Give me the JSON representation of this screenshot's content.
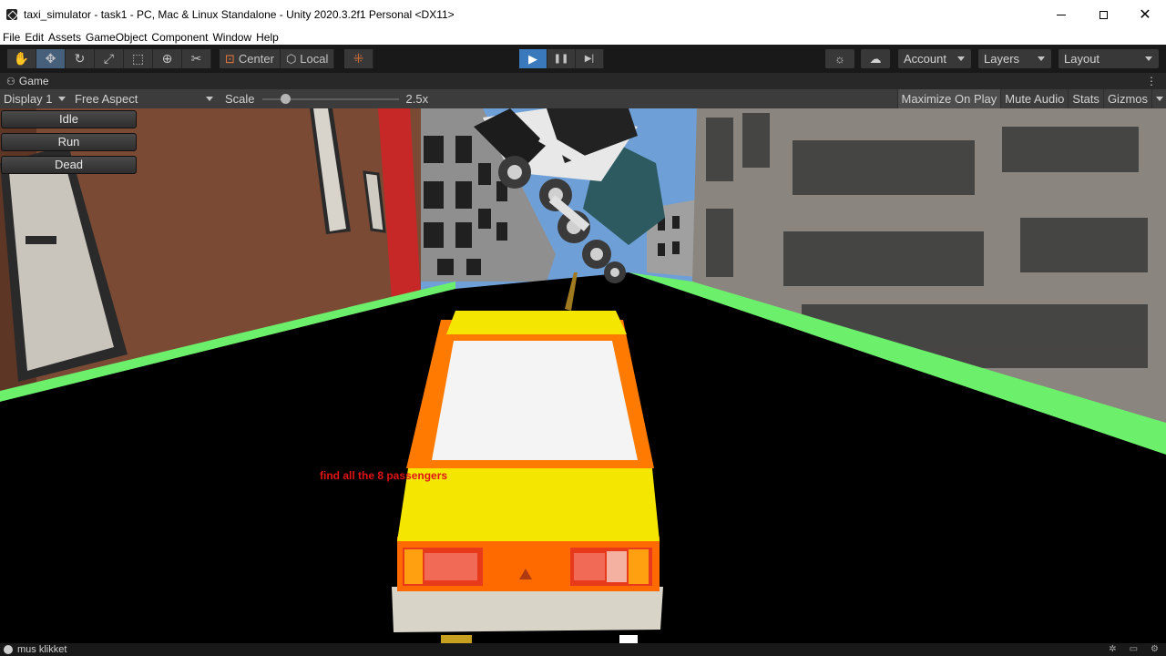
{
  "window": {
    "title": "taxi_simulator - task1 - PC, Mac & Linux Standalone - Unity 2020.3.2f1 Personal <DX11>",
    "minimize_glyph": "—",
    "maximize_glyph": "☐",
    "close_glyph": "✕"
  },
  "menu": [
    "File",
    "Edit",
    "Assets",
    "GameObject",
    "Component",
    "Window",
    "Help"
  ],
  "toolbar": {
    "tools": [
      {
        "name": "hand-tool",
        "glyph": "✋"
      },
      {
        "name": "move-tool",
        "glyph": "✥"
      },
      {
        "name": "rotate-tool",
        "glyph": "↻"
      },
      {
        "name": "scale-tool",
        "glyph": "⤢"
      },
      {
        "name": "rect-tool",
        "glyph": "⬚"
      },
      {
        "name": "transform-tool",
        "glyph": "⊕"
      },
      {
        "name": "custom-tool",
        "glyph": "✂"
      }
    ],
    "pivot_label": "Center",
    "space_label": "Local",
    "play_glyph": "▶",
    "pause_glyph": "❚❚",
    "step_glyph": "▶|",
    "account_label": "Account",
    "layers_label": "Layers",
    "layout_label": "Layout"
  },
  "game_tab": {
    "label": "Game",
    "menu_glyph": "⋮"
  },
  "game_options": {
    "display": "Display 1",
    "aspect": "Free Aspect",
    "scale_label": "Scale",
    "scale_value": "2.5x",
    "scale_fraction": 0.15,
    "maximize_on_play": "Maximize On Play",
    "mute_audio": "Mute Audio",
    "stats": "Stats",
    "gizmos": "Gizmos"
  },
  "gui_buttons": [
    "Idle",
    "Run",
    "Dead"
  ],
  "hud": {
    "message": "find all the 8 passengers"
  },
  "status": {
    "message": "mus klikket"
  },
  "colors": {
    "accent_play": "#3a79bb",
    "grass": "#6cf06c",
    "taxi_yellow": "#f5e600",
    "taxi_orange": "#ff7a00",
    "hud_red": "#e01414"
  }
}
